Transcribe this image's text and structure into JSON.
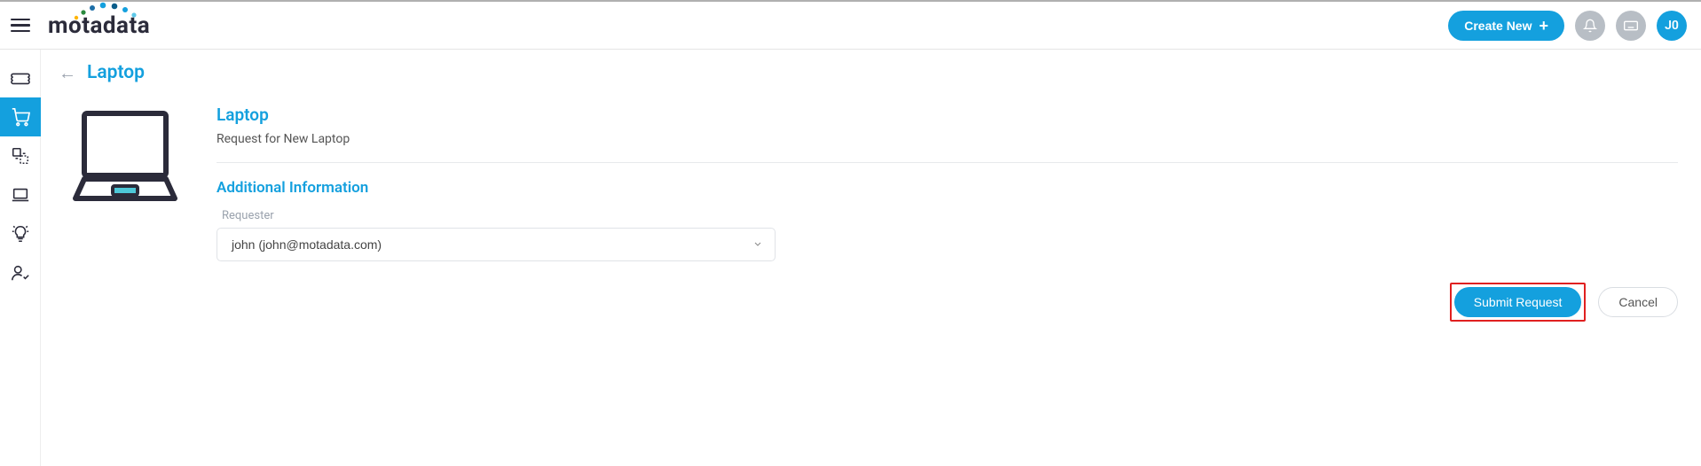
{
  "header": {
    "brand": "motadata",
    "create_label": "Create New",
    "avatar_initials": "J0"
  },
  "page": {
    "title": "Laptop"
  },
  "item": {
    "title": "Laptop",
    "description": "Request for New Laptop"
  },
  "form": {
    "section_title": "Additional Information",
    "requester_label": "Requester",
    "requester_value": "john (john@motadata.com)"
  },
  "actions": {
    "submit_label": "Submit Request",
    "cancel_label": "Cancel"
  }
}
